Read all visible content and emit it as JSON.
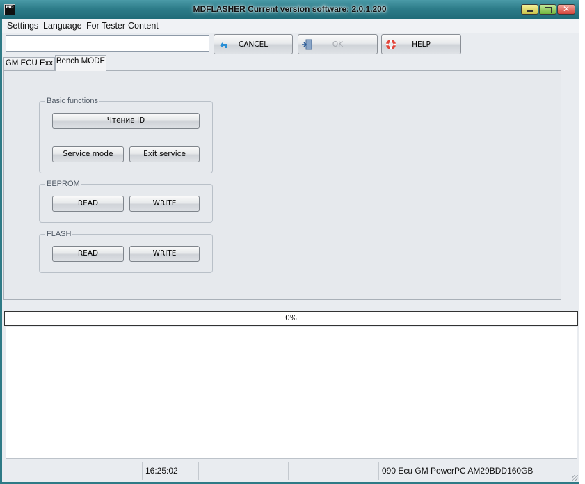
{
  "window": {
    "title": "MDFLASHER  Current version software: 2.0.1.200",
    "app_icon_text": "MD"
  },
  "menu": {
    "items": [
      "Settings",
      "Language",
      "For Tester",
      "Content"
    ]
  },
  "toolbar": {
    "input_value": "",
    "cancel_label": "CANCEL",
    "ok_label": "OK",
    "help_label": "HELP",
    "cancel_icon": "back-arrow-icon",
    "ok_icon": "exit-door-icon",
    "help_icon": "lifebuoy-icon",
    "ok_enabled": false
  },
  "tabs": [
    {
      "label": "GM ECU Exx",
      "active": false
    },
    {
      "label": "Bench MODE",
      "active": true
    }
  ],
  "groups": {
    "basic": {
      "legend": "Basic functions",
      "read_id": "Чтение ID",
      "service_mode": "Service mode",
      "exit_service": "Exit service"
    },
    "eeprom": {
      "legend": "EEPROM",
      "read": "READ",
      "write": "WRITE"
    },
    "flash": {
      "legend": "FLASH",
      "read": "READ",
      "write": "WRITE"
    }
  },
  "progress": {
    "text": "0%",
    "value": 0
  },
  "log": {
    "lines": []
  },
  "status": {
    "panel1": "",
    "time": "16:25:02",
    "panel3": "",
    "panel4": "",
    "device": "090 Ecu GM PowerPC AM29BDD160GB"
  },
  "colors": {
    "title_bar": "#2d7c89",
    "client_bg": "#e9ecf0",
    "panel_bg": "#e6e9ed",
    "close_button": "#d2443a",
    "minimize_button": "#c9c24a",
    "maximize_button": "#6fb53b"
  }
}
